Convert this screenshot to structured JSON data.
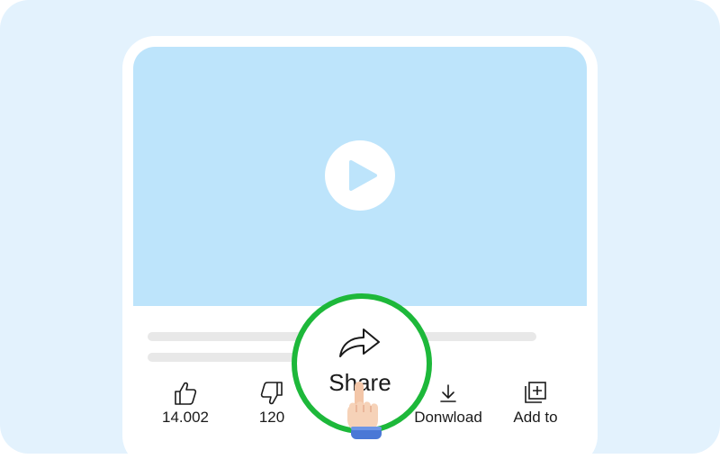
{
  "video": {
    "play_icon": "play-icon"
  },
  "actions": {
    "like": {
      "icon": "thumbs-up-icon",
      "label": "14.002"
    },
    "dislike": {
      "icon": "thumbs-down-icon",
      "label": "120"
    },
    "share": {
      "icon": "share-arrow-icon",
      "label": "Share"
    },
    "download": {
      "icon": "download-icon",
      "label": "Donwload"
    },
    "add_to": {
      "icon": "add-to-playlist-icon",
      "label": "Add to"
    }
  },
  "colors": {
    "background": "#e3f2fd",
    "video_placeholder": "#bde4fb",
    "play_icon": "#bde4fb",
    "highlight_ring": "#1db83a",
    "text": "#1a1a1a"
  }
}
